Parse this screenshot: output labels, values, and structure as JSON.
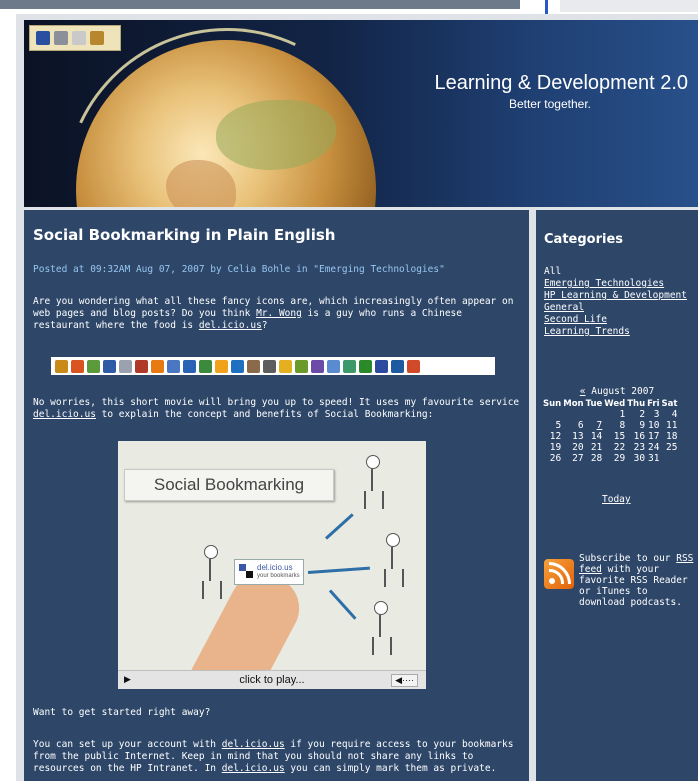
{
  "header": {
    "title": "Learning & Development 2.0",
    "tagline": "Better together."
  },
  "post": {
    "title": "Social Bookmarking in Plain English",
    "meta": "Posted at 09:32AM Aug 07, 2007 by Celia Bohle in \"Emerging Technologies\"",
    "p1_a": "Are you wondering what all these fancy icons are, which increasingly often appear on web pages and blog posts? Do you think ",
    "p1_link1": "Mr. Wong",
    "p1_b": " is a guy who runs a Chinese restaurant where the food is ",
    "p1_link2": "del.icio.us",
    "p1_c": "?",
    "p2_a": "No worries, this short movie will bring you up to speed! It uses my favourite service ",
    "p2_link": "del.icio.us",
    "p2_b": " to explain the concept and benefits of Social Bookmarking:",
    "video": {
      "label": "Social Bookmarking",
      "card_title": "del.icio.us",
      "card_sub": "your bookmarks",
      "control_label": "click to play..."
    },
    "p3": "Want to get started right away?",
    "p4_a": "You can set up your account with ",
    "p4_link1": "del.icio.us",
    "p4_b": " if you require access to your bookmarks from the public Internet. Keep in mind that you should not share any links to resources on the HP Intranet. In ",
    "p4_link2": "del.icio.us",
    "p4_c": " you can simply mark them as private."
  },
  "bookmark_icons": [
    "#c98a1a",
    "#d9531e",
    "#5a9a3a",
    "#2f5aa6",
    "#9aa2b0",
    "#b03a2a",
    "#e87a12",
    "#4a77c4",
    "#2b62b5",
    "#3c8a3c",
    "#f1a21d",
    "#1e6fc0",
    "#8a6a4a",
    "#5d5d5d",
    "#e5b020",
    "#6a9a2a",
    "#6c4aa8",
    "#5a8ad0",
    "#3c9a6a",
    "#2a8a2a",
    "#2d4aa0",
    "#1e5aa0",
    "#d04a2a"
  ],
  "sidebar": {
    "heading": "Categories",
    "categories": [
      {
        "label": "All",
        "link": false
      },
      {
        "label": "Emerging Technologies",
        "link": true
      },
      {
        "label": "HP Learning & Development",
        "link": true
      },
      {
        "label": "General",
        "link": true
      },
      {
        "label": "Second Life",
        "link": true
      },
      {
        "label": "Learning Trends",
        "link": true
      }
    ],
    "calendar": {
      "prev": "«",
      "month": "August 2007",
      "weekdays": [
        "Sun",
        "Mon",
        "Tue",
        "Wed",
        "Thu",
        "Fri",
        "Sat"
      ],
      "weeks": [
        [
          "",
          "",
          "",
          "1",
          "2",
          "3",
          "4"
        ],
        [
          "5",
          "6",
          "7",
          "8",
          "9",
          "10",
          "11"
        ],
        [
          "12",
          "13",
          "14",
          "15",
          "16",
          "17",
          "18"
        ],
        [
          "19",
          "20",
          "21",
          "22",
          "23",
          "24",
          "25"
        ],
        [
          "26",
          "27",
          "28",
          "29",
          "30",
          "31",
          ""
        ]
      ],
      "linked_day": "7",
      "today": "Today"
    },
    "rss": {
      "a": "Subscribe to our ",
      "link": "RSS feed",
      "b": " with your favorite RSS Reader or iTunes to download podcasts."
    }
  }
}
